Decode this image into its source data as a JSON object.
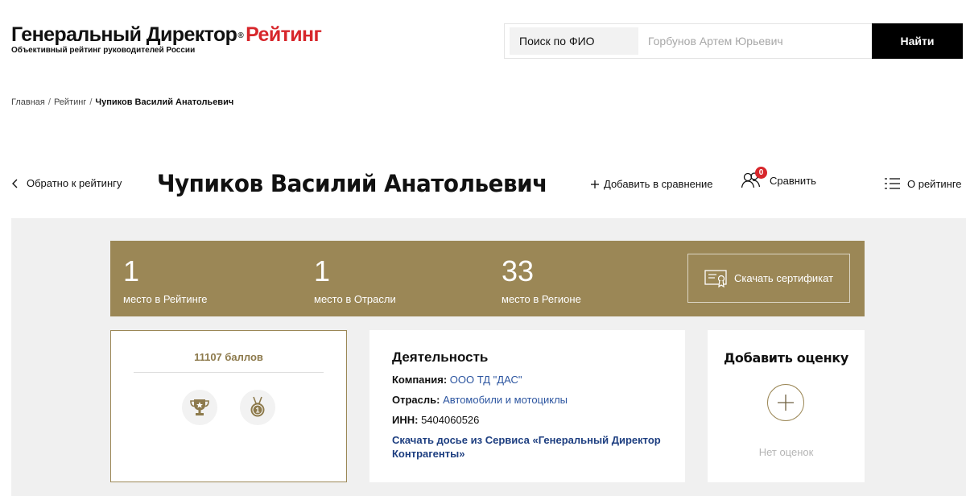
{
  "header": {
    "logo_black": "Генеральный Директор",
    "logo_reg": "®",
    "logo_red": "Рейтинг",
    "tagline": "Объективный рейтинг руководителей России",
    "search": {
      "type_label": "Поиск по ФИО",
      "placeholder": "Горбунов Артем Юрьевич",
      "button_label": "Найти"
    }
  },
  "breadcrumb": {
    "items": [
      "Главная",
      "Рейтинг"
    ],
    "separator": "/",
    "current": "Чупиков Василий Анатольевич"
  },
  "title_row": {
    "back_label": "Обратно к рейтингу",
    "title": "Чупиков Василий Анатольевич",
    "add_compare_label": "Добавить в сравнение",
    "compare_label": "Сравнить",
    "compare_count": "0",
    "about_label": "О рейтинге"
  },
  "ranks": [
    {
      "value": "1",
      "label": "место в Рейтинге"
    },
    {
      "value": "1",
      "label": "место в Отрасли"
    },
    {
      "value": "33",
      "label": "место в Регионе"
    }
  ],
  "certificate_label": "Скачать сертификат",
  "score_card": {
    "score": "11107 баллов",
    "medals": [
      "trophy-icon",
      "medal-first-place-icon"
    ]
  },
  "activity": {
    "title": "Деятельность",
    "company_label": "Компания:",
    "company_value": "ООО ТД \"ДАС\"",
    "industry_label": "Отрасль:",
    "industry_value": "Автомобили и мотоциклы",
    "inn_label": "ИНН:",
    "inn_value": "5404060526",
    "dossier_link": "Скачать досье из Сервиса «Генеральный Директор Контрагенты»"
  },
  "rating_card": {
    "title": "Добавить оценку",
    "plus": "+",
    "empty_text": "Нет оценок"
  },
  "colors": {
    "brand_red": "#d7262b",
    "gold": "#9b8756",
    "gray_bg": "#f0f0f0",
    "link_blue": "#2c55a0"
  }
}
